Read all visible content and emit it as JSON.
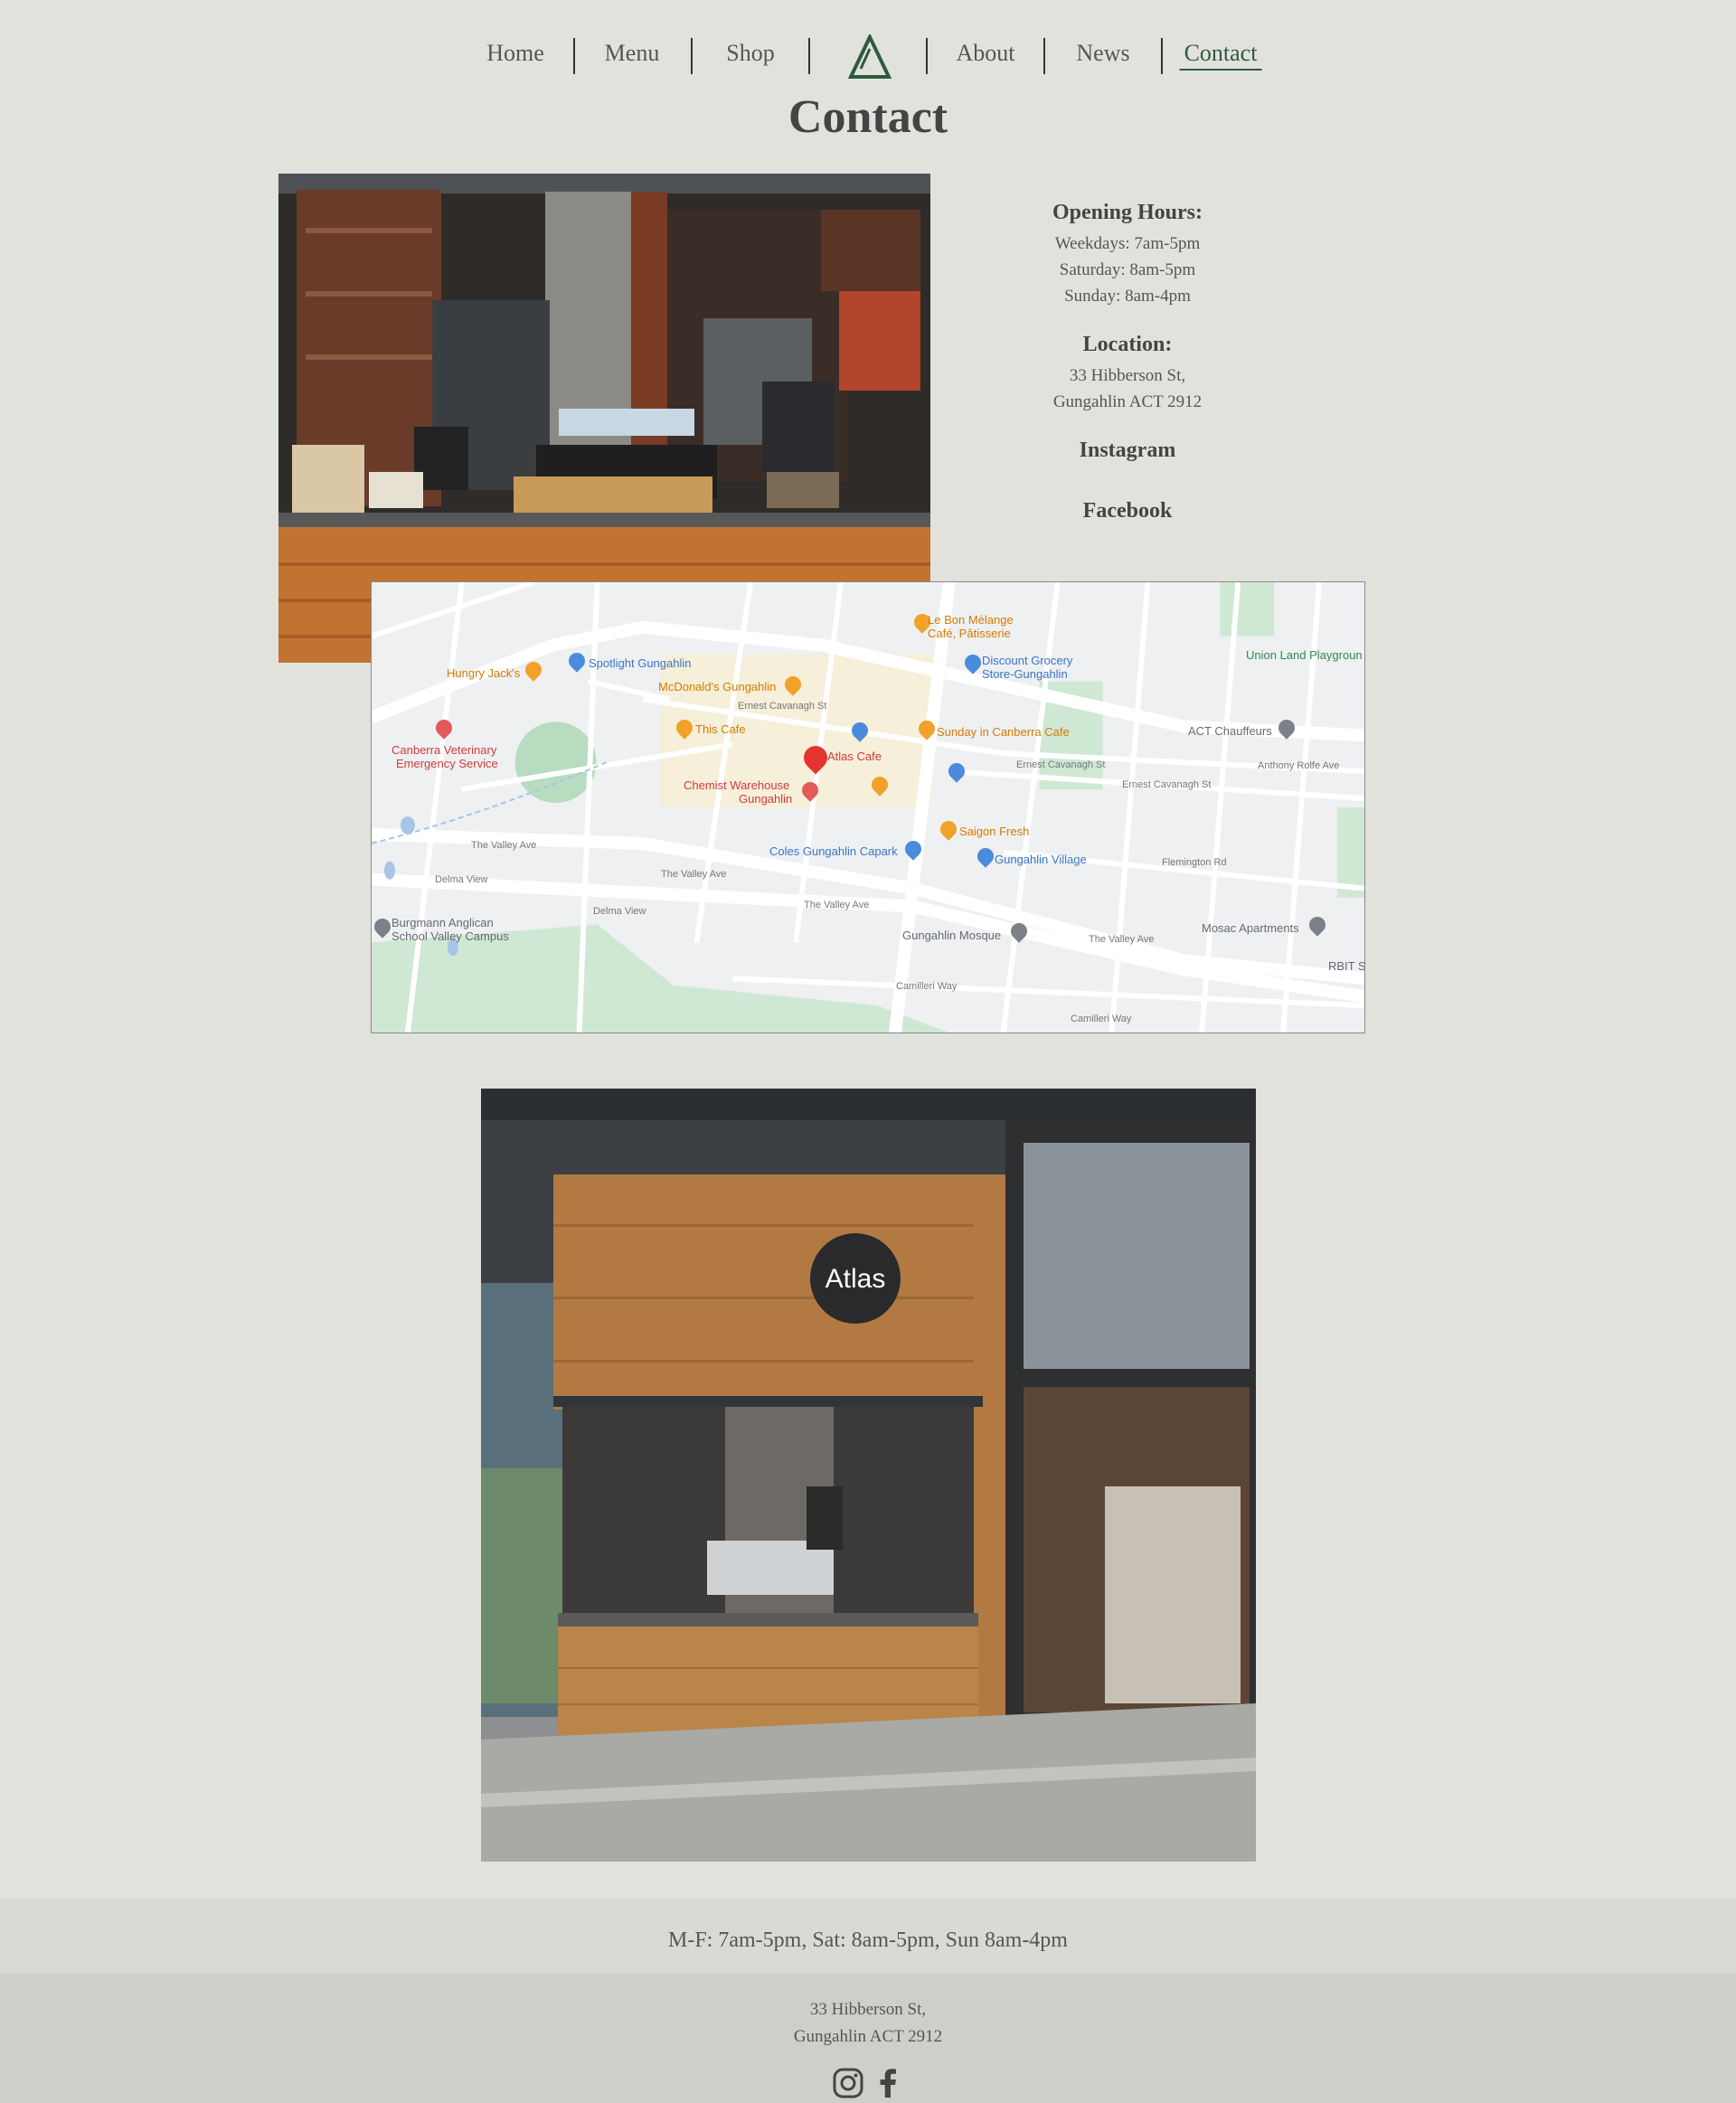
{
  "nav": {
    "items": [
      {
        "label": "Home"
      },
      {
        "label": "Menu"
      },
      {
        "label": "Shop"
      },
      {
        "label": "About"
      },
      {
        "label": "News"
      },
      {
        "label": "Contact"
      }
    ],
    "logo_icon": "triangle-logo-icon",
    "active": "Contact",
    "accent_color": "#2f5a3d"
  },
  "page": {
    "title": "Contact"
  },
  "info": {
    "hours_heading": "Opening Hours:",
    "hours": [
      "Weekdays: 7am-5pm",
      "Saturday: 8am-5pm",
      "Sunday: 8am-4pm"
    ],
    "location_heading": "Location:",
    "address": [
      "33 Hibberson St,",
      "Gungahlin ACT 2912"
    ],
    "instagram": "Instagram",
    "facebook": "Facebook"
  },
  "map": {
    "labels": {
      "le_bon": "Le Bon Mélange",
      "le_bon2": "Café, Pâtisserie",
      "hungry_jacks": "Hungry Jack's",
      "spotlight": "Spotlight Gungahlin",
      "discount": "Discount Grocery",
      "discount2": "Store-Gungahlin",
      "union": "Union Land Playgroun",
      "mcdonalds": "McDonald's Gungahlin",
      "this_cafe": "This Cafe",
      "sunday": "Sunday in Canberra Cafe",
      "act_chauffeurs": "ACT Chauffeurs",
      "vet": "Canberra Veterinary",
      "vet2": "Emergency Service",
      "atlas": "Atlas Cafe",
      "chemist": "Chemist Warehouse",
      "chemist2": "Gungahlin",
      "saigon": "Saigon Fresh",
      "coles": "Coles Gungahlin Capark",
      "village": "Gungahlin Village",
      "mosque": "Gungahlin Mosque",
      "burgmann": "Burgmann Anglican",
      "burgmann2": "School Valley Campus",
      "mosac": "Mosac Apartments",
      "rbit": "RBIT S",
      "valley1": "The Valley Ave",
      "valley2": "The Valley Ave",
      "valley3": "The Valley Ave",
      "valley4": "The Valley Ave",
      "flemington": "Flemington Rd",
      "anthony": "Anthony Rolfe Ave",
      "ernest1": "Ernest Cavanagh St",
      "ernest2": "Ernest Cavanagh St",
      "ernest3": "Ernest Cavanagh St",
      "delma1": "Delma View",
      "delma2": "Delma View",
      "camilleri1": "Camilleri Way",
      "camilleri2": "Camilleri Way"
    }
  },
  "footer": {
    "hours": "M-F: 7am-5pm, Sat: 8am-5pm, Sun 8am-4pm",
    "address": [
      "33 Hibberson St,",
      "Gungahlin ACT 2912"
    ],
    "social": [
      "instagram-icon",
      "facebook-icon"
    ]
  }
}
